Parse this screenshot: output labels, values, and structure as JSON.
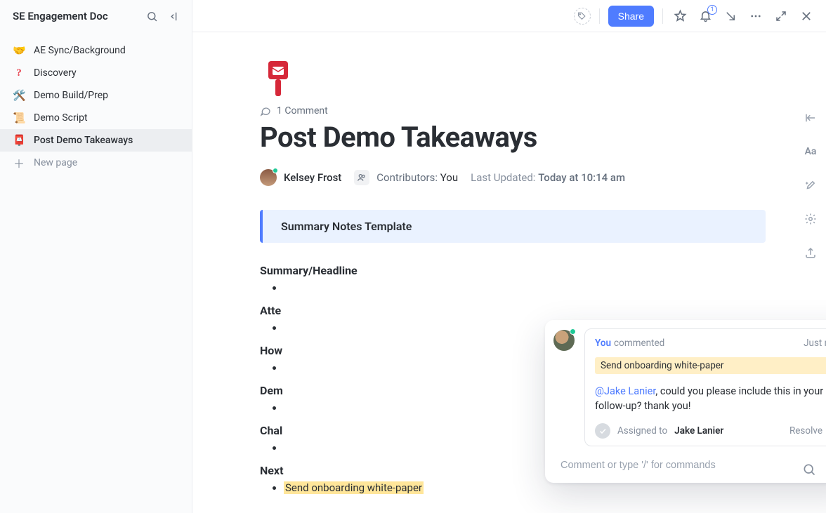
{
  "sidebar": {
    "title": "SE Engagement Doc",
    "items": [
      {
        "emoji": "🤝",
        "label": "AE Sync/Background"
      },
      {
        "emoji": "?",
        "label": "Discovery"
      },
      {
        "emoji": "🛠️",
        "label": "Demo Build/Prep"
      },
      {
        "emoji": "📜",
        "label": "Demo Script"
      },
      {
        "emoji": "📮",
        "label": "Post Demo Takeaways"
      }
    ],
    "new_page": "New page"
  },
  "topbar": {
    "share": "Share",
    "bell_count": "1"
  },
  "doc": {
    "comment_count": "1 Comment",
    "title": "Post Demo Takeaways",
    "author": "Kelsey Frost",
    "contributors_label": "Contributors:",
    "contributors_value": "You",
    "last_updated_label": "Last Updated:",
    "last_updated_value": "Today at 10:14 am",
    "callout": "Summary Notes Template",
    "sections": [
      "Summary/Headline",
      "Atte",
      "How",
      "Dem",
      "Chal",
      "Next"
    ],
    "next_step_item": "Send onboarding white-paper"
  },
  "popover": {
    "you": "You",
    "verb": "commented",
    "time": "Just now",
    "quote": "Send onboarding white-paper",
    "mention": "@Jake Lanier",
    "body_rest": ", could you please include this in your follow-up? thank you!",
    "assigned_label": "Assigned to",
    "assignee": "Jake Lanier",
    "resolve": "Resolve",
    "input_placeholder": "Comment or type '/' for commands"
  },
  "rail": {
    "typography": "Aa"
  }
}
